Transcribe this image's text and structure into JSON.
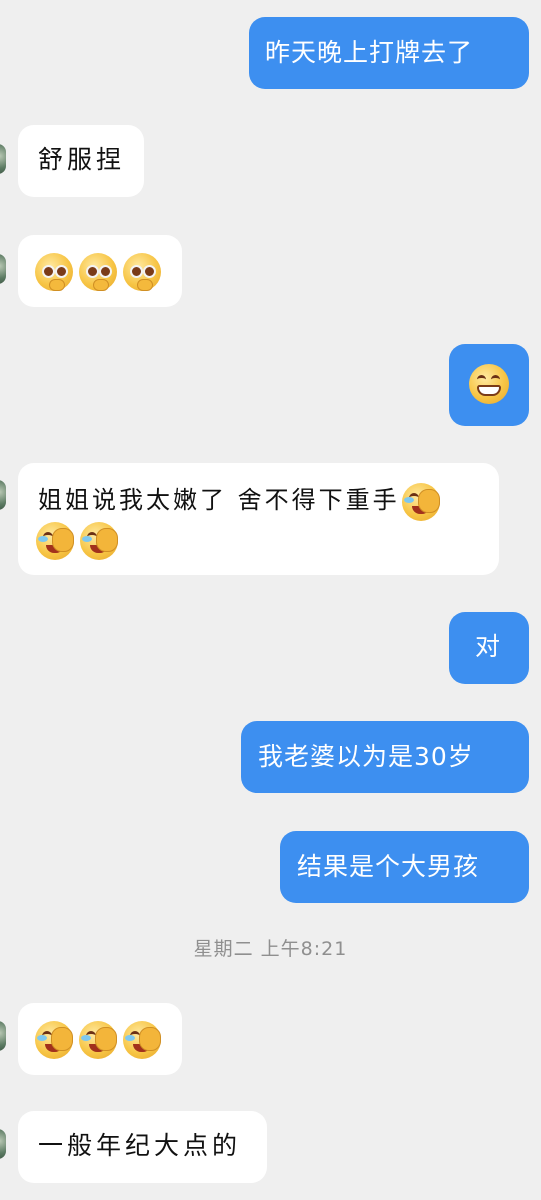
{
  "messages": [
    {
      "side": "out",
      "text": "昨天晚上打牌去了"
    },
    {
      "side": "in",
      "text": "舒服捏"
    },
    {
      "side": "in",
      "emojis": [
        "shy-blush-emoji",
        "shy-blush-emoji",
        "shy-blush-emoji"
      ]
    },
    {
      "side": "out",
      "emojis": [
        "grin-emoji"
      ]
    },
    {
      "side": "in",
      "text": "姐姐说我太嫩了 舍不得下重手",
      "emojis": [
        "laugh-cry-emoji",
        "laugh-cry-emoji",
        "laugh-cry-emoji"
      ]
    },
    {
      "side": "out",
      "text": "对"
    },
    {
      "side": "out",
      "text": "我老婆以为是30岁"
    },
    {
      "side": "out",
      "text": "结果是个大男孩"
    },
    {
      "side": "in",
      "emojis": [
        "laugh-cry-emoji",
        "laugh-cry-emoji",
        "laugh-cry-emoji"
      ]
    },
    {
      "side": "in",
      "text": "一般年纪大点的"
    }
  ],
  "timestamp": "星期二 上午8:21",
  "colors": {
    "background": "#efefef",
    "outgoing_bubble": "#3d8ff0",
    "incoming_bubble": "#ffffff"
  }
}
